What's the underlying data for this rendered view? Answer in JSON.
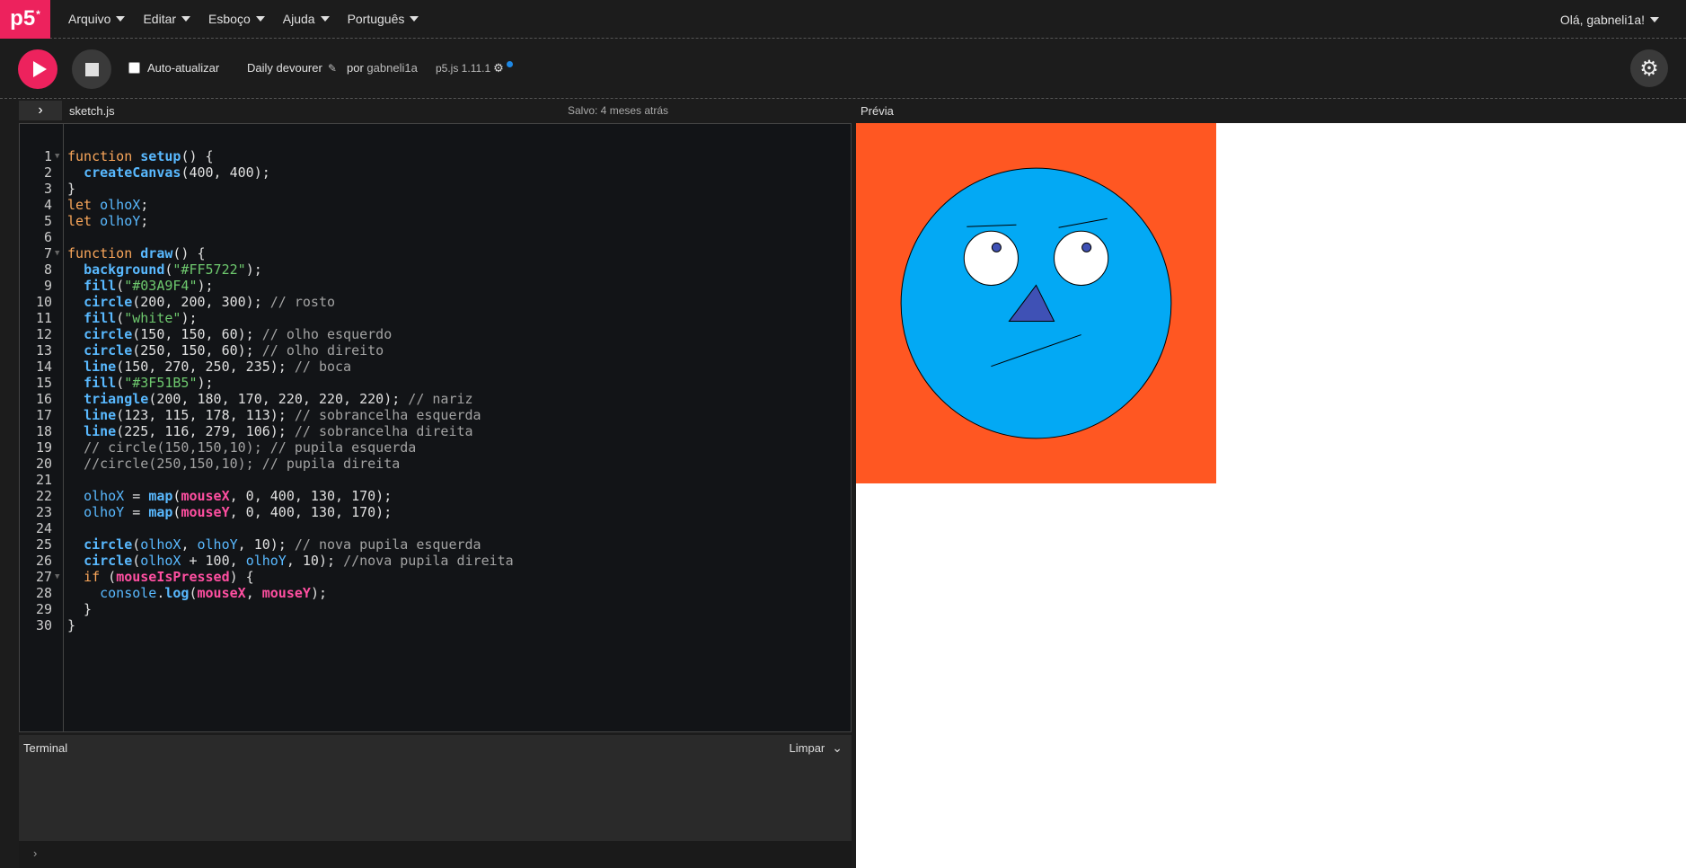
{
  "nav": {
    "logo": "p5",
    "logo_sup": "*",
    "menu": [
      "Arquivo",
      "Editar",
      "Esboço",
      "Ajuda",
      "Português"
    ],
    "user_greeting": "Olá, gabneli1a!"
  },
  "toolbar": {
    "autorefresh_label": "Auto-atualizar",
    "sketch_name": "Daily devourer",
    "by_label": "por",
    "owner": "gabneli1a",
    "version": "p5.js 1.11.1"
  },
  "editor": {
    "file_name": "sketch.js",
    "saved_status": "Salvo: 4 meses atrás",
    "preview_label": "Prévia",
    "lines": [
      "1",
      "2",
      "3",
      "4",
      "5",
      "6",
      "7",
      "8",
      "9",
      "10",
      "11",
      "12",
      "13",
      "14",
      "15",
      "16",
      "17",
      "18",
      "19",
      "20",
      "21",
      "22",
      "23",
      "24",
      "25",
      "26",
      "27",
      "28",
      "29",
      "30"
    ]
  },
  "terminal": {
    "title": "Terminal",
    "clear_label": "Limpar",
    "prompt": "›"
  },
  "colors": {
    "background": "#FF5722",
    "face": "#03A9F4",
    "eye": "white",
    "nose": "#3F51B5",
    "accent": "#ed225d"
  },
  "icons": {
    "play": "play-icon",
    "stop": "stop-icon",
    "settings": "gear-icon",
    "pencil": "pencil-icon",
    "chevron": "chevron-down-icon",
    "sidebar": "chevron-right-icon"
  }
}
